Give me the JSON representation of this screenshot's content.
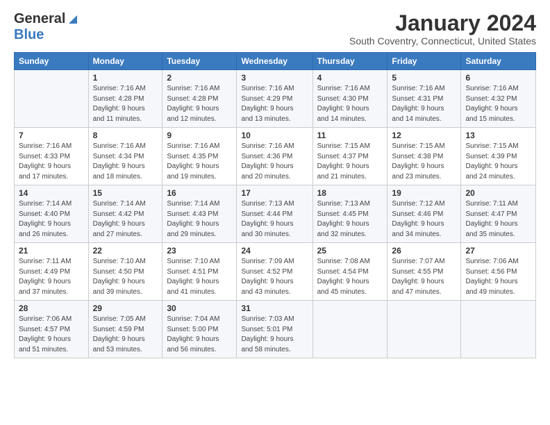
{
  "header": {
    "logo_general": "General",
    "logo_blue": "Blue",
    "month_title": "January 2024",
    "location": "South Coventry, Connecticut, United States"
  },
  "weekdays": [
    "Sunday",
    "Monday",
    "Tuesday",
    "Wednesday",
    "Thursday",
    "Friday",
    "Saturday"
  ],
  "weeks": [
    [
      {
        "num": "",
        "sunrise": "",
        "sunset": "",
        "daylight": "",
        "empty": true
      },
      {
        "num": "1",
        "sunrise": "Sunrise: 7:16 AM",
        "sunset": "Sunset: 4:28 PM",
        "daylight": "Daylight: 9 hours",
        "daylight2": "and 11 minutes."
      },
      {
        "num": "2",
        "sunrise": "Sunrise: 7:16 AM",
        "sunset": "Sunset: 4:28 PM",
        "daylight": "Daylight: 9 hours",
        "daylight2": "and 12 minutes."
      },
      {
        "num": "3",
        "sunrise": "Sunrise: 7:16 AM",
        "sunset": "Sunset: 4:29 PM",
        "daylight": "Daylight: 9 hours",
        "daylight2": "and 13 minutes."
      },
      {
        "num": "4",
        "sunrise": "Sunrise: 7:16 AM",
        "sunset": "Sunset: 4:30 PM",
        "daylight": "Daylight: 9 hours",
        "daylight2": "and 14 minutes."
      },
      {
        "num": "5",
        "sunrise": "Sunrise: 7:16 AM",
        "sunset": "Sunset: 4:31 PM",
        "daylight": "Daylight: 9 hours",
        "daylight2": "and 14 minutes."
      },
      {
        "num": "6",
        "sunrise": "Sunrise: 7:16 AM",
        "sunset": "Sunset: 4:32 PM",
        "daylight": "Daylight: 9 hours",
        "daylight2": "and 15 minutes."
      }
    ],
    [
      {
        "num": "7",
        "sunrise": "Sunrise: 7:16 AM",
        "sunset": "Sunset: 4:33 PM",
        "daylight": "Daylight: 9 hours",
        "daylight2": "and 17 minutes."
      },
      {
        "num": "8",
        "sunrise": "Sunrise: 7:16 AM",
        "sunset": "Sunset: 4:34 PM",
        "daylight": "Daylight: 9 hours",
        "daylight2": "and 18 minutes."
      },
      {
        "num": "9",
        "sunrise": "Sunrise: 7:16 AM",
        "sunset": "Sunset: 4:35 PM",
        "daylight": "Daylight: 9 hours",
        "daylight2": "and 19 minutes."
      },
      {
        "num": "10",
        "sunrise": "Sunrise: 7:16 AM",
        "sunset": "Sunset: 4:36 PM",
        "daylight": "Daylight: 9 hours",
        "daylight2": "and 20 minutes."
      },
      {
        "num": "11",
        "sunrise": "Sunrise: 7:15 AM",
        "sunset": "Sunset: 4:37 PM",
        "daylight": "Daylight: 9 hours",
        "daylight2": "and 21 minutes."
      },
      {
        "num": "12",
        "sunrise": "Sunrise: 7:15 AM",
        "sunset": "Sunset: 4:38 PM",
        "daylight": "Daylight: 9 hours",
        "daylight2": "and 23 minutes."
      },
      {
        "num": "13",
        "sunrise": "Sunrise: 7:15 AM",
        "sunset": "Sunset: 4:39 PM",
        "daylight": "Daylight: 9 hours",
        "daylight2": "and 24 minutes."
      }
    ],
    [
      {
        "num": "14",
        "sunrise": "Sunrise: 7:14 AM",
        "sunset": "Sunset: 4:40 PM",
        "daylight": "Daylight: 9 hours",
        "daylight2": "and 26 minutes."
      },
      {
        "num": "15",
        "sunrise": "Sunrise: 7:14 AM",
        "sunset": "Sunset: 4:42 PM",
        "daylight": "Daylight: 9 hours",
        "daylight2": "and 27 minutes."
      },
      {
        "num": "16",
        "sunrise": "Sunrise: 7:14 AM",
        "sunset": "Sunset: 4:43 PM",
        "daylight": "Daylight: 9 hours",
        "daylight2": "and 29 minutes."
      },
      {
        "num": "17",
        "sunrise": "Sunrise: 7:13 AM",
        "sunset": "Sunset: 4:44 PM",
        "daylight": "Daylight: 9 hours",
        "daylight2": "and 30 minutes."
      },
      {
        "num": "18",
        "sunrise": "Sunrise: 7:13 AM",
        "sunset": "Sunset: 4:45 PM",
        "daylight": "Daylight: 9 hours",
        "daylight2": "and 32 minutes."
      },
      {
        "num": "19",
        "sunrise": "Sunrise: 7:12 AM",
        "sunset": "Sunset: 4:46 PM",
        "daylight": "Daylight: 9 hours",
        "daylight2": "and 34 minutes."
      },
      {
        "num": "20",
        "sunrise": "Sunrise: 7:11 AM",
        "sunset": "Sunset: 4:47 PM",
        "daylight": "Daylight: 9 hours",
        "daylight2": "and 35 minutes."
      }
    ],
    [
      {
        "num": "21",
        "sunrise": "Sunrise: 7:11 AM",
        "sunset": "Sunset: 4:49 PM",
        "daylight": "Daylight: 9 hours",
        "daylight2": "and 37 minutes."
      },
      {
        "num": "22",
        "sunrise": "Sunrise: 7:10 AM",
        "sunset": "Sunset: 4:50 PM",
        "daylight": "Daylight: 9 hours",
        "daylight2": "and 39 minutes."
      },
      {
        "num": "23",
        "sunrise": "Sunrise: 7:10 AM",
        "sunset": "Sunset: 4:51 PM",
        "daylight": "Daylight: 9 hours",
        "daylight2": "and 41 minutes."
      },
      {
        "num": "24",
        "sunrise": "Sunrise: 7:09 AM",
        "sunset": "Sunset: 4:52 PM",
        "daylight": "Daylight: 9 hours",
        "daylight2": "and 43 minutes."
      },
      {
        "num": "25",
        "sunrise": "Sunrise: 7:08 AM",
        "sunset": "Sunset: 4:54 PM",
        "daylight": "Daylight: 9 hours",
        "daylight2": "and 45 minutes."
      },
      {
        "num": "26",
        "sunrise": "Sunrise: 7:07 AM",
        "sunset": "Sunset: 4:55 PM",
        "daylight": "Daylight: 9 hours",
        "daylight2": "and 47 minutes."
      },
      {
        "num": "27",
        "sunrise": "Sunrise: 7:06 AM",
        "sunset": "Sunset: 4:56 PM",
        "daylight": "Daylight: 9 hours",
        "daylight2": "and 49 minutes."
      }
    ],
    [
      {
        "num": "28",
        "sunrise": "Sunrise: 7:06 AM",
        "sunset": "Sunset: 4:57 PM",
        "daylight": "Daylight: 9 hours",
        "daylight2": "and 51 minutes."
      },
      {
        "num": "29",
        "sunrise": "Sunrise: 7:05 AM",
        "sunset": "Sunset: 4:59 PM",
        "daylight": "Daylight: 9 hours",
        "daylight2": "and 53 minutes."
      },
      {
        "num": "30",
        "sunrise": "Sunrise: 7:04 AM",
        "sunset": "Sunset: 5:00 PM",
        "daylight": "Daylight: 9 hours",
        "daylight2": "and 56 minutes."
      },
      {
        "num": "31",
        "sunrise": "Sunrise: 7:03 AM",
        "sunset": "Sunset: 5:01 PM",
        "daylight": "Daylight: 9 hours",
        "daylight2": "and 58 minutes."
      },
      {
        "num": "",
        "sunrise": "",
        "sunset": "",
        "daylight": "",
        "daylight2": "",
        "empty": true
      },
      {
        "num": "",
        "sunrise": "",
        "sunset": "",
        "daylight": "",
        "daylight2": "",
        "empty": true
      },
      {
        "num": "",
        "sunrise": "",
        "sunset": "",
        "daylight": "",
        "daylight2": "",
        "empty": true
      }
    ]
  ]
}
